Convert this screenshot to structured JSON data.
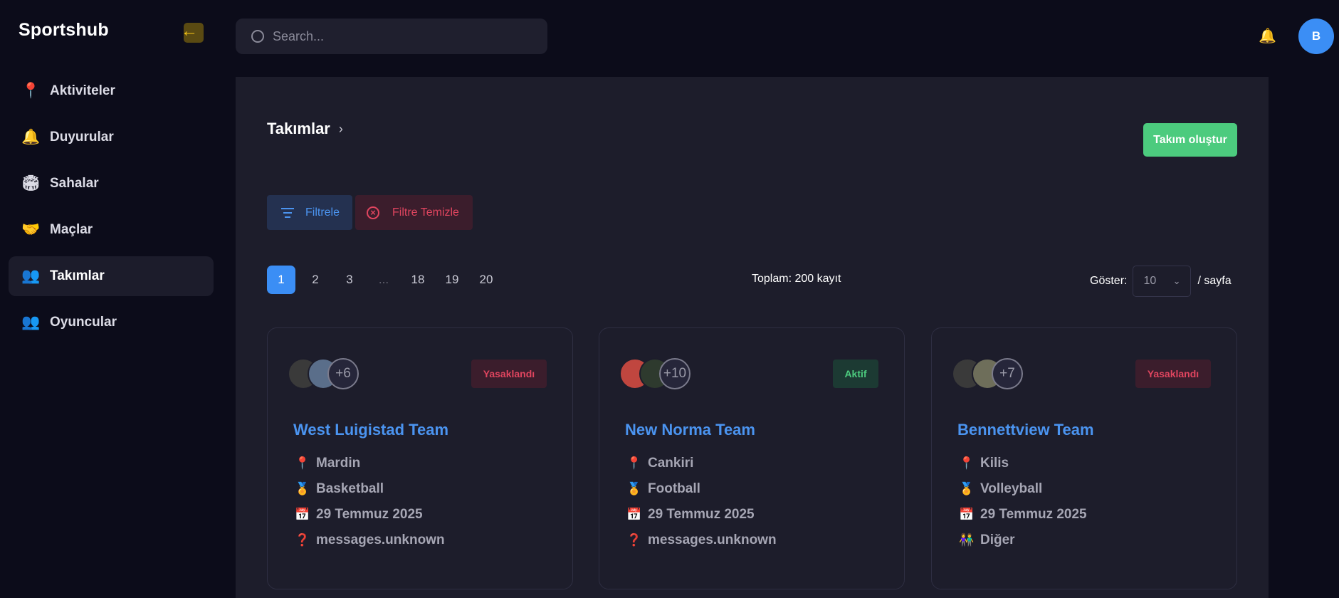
{
  "app": {
    "brand": "Sportshub",
    "collapse_icon": "←"
  },
  "sidebar": {
    "items": [
      {
        "label": "Aktiviteler",
        "icon": "📍",
        "icon_name": "pin-icon"
      },
      {
        "label": "Duyurular",
        "icon": "🔔",
        "icon_name": "bell-icon"
      },
      {
        "label": "Sahalar",
        "icon": "🏟",
        "icon_name": "stadium-icon"
      },
      {
        "label": "Maçlar",
        "icon": "🤝",
        "icon_name": "handshake-icon"
      },
      {
        "label": "Takımlar",
        "icon": "👥",
        "icon_name": "team-icon"
      },
      {
        "label": "Oyuncular",
        "icon": "👥",
        "icon_name": "players-icon"
      }
    ],
    "active_index": 4
  },
  "topbar": {
    "search_placeholder": "Search...",
    "notification_icon": "🔔",
    "avatar_initial": "B"
  },
  "page": {
    "breadcrumb": "Takımlar",
    "breadcrumb_chevron": "›",
    "create_button": "Takım oluştur",
    "filter_button": "Filtrele",
    "clear_filter_button": "Filtre Temizle",
    "clear_icon": "×"
  },
  "pagination": {
    "pages": [
      "1",
      "2",
      "3",
      "...",
      "18",
      "19",
      "20"
    ],
    "current": "1",
    "total_text": "Toplam: 200 kayıt",
    "show_label": "Göster:",
    "per_page": "10",
    "per_page_suffix": "/ sayfa"
  },
  "teams": [
    {
      "name": "West Luigistad Team",
      "status": "Yasaklandı",
      "status_type": "banned",
      "more_members": "+6",
      "avatar_colors": [
        "#3a3a3a",
        "#5a6e8a"
      ],
      "city": "Mardin",
      "sport": "Basketball",
      "date": "29 Temmuz 2025",
      "extra": "messages.unknown",
      "extra_icon": "❓"
    },
    {
      "name": "New Norma Team",
      "status": "Aktif",
      "status_type": "active",
      "more_members": "+10",
      "avatar_colors": [
        "#c0463f",
        "#2e3a2e"
      ],
      "city": "Cankiri",
      "sport": "Football",
      "date": "29 Temmuz 2025",
      "extra": "messages.unknown",
      "extra_icon": "❓"
    },
    {
      "name": "Bennettview Team",
      "status": "Yasaklandı",
      "status_type": "banned",
      "more_members": "+7",
      "avatar_colors": [
        "#3a3a3a",
        "#6e6e5a"
      ],
      "city": "Kilis",
      "sport": "Volleyball",
      "date": "29 Temmuz 2025",
      "extra": "Diğer",
      "extra_icon": "👫"
    }
  ],
  "row_icons": {
    "city": "📍",
    "sport": "🏅",
    "date": "📅"
  }
}
